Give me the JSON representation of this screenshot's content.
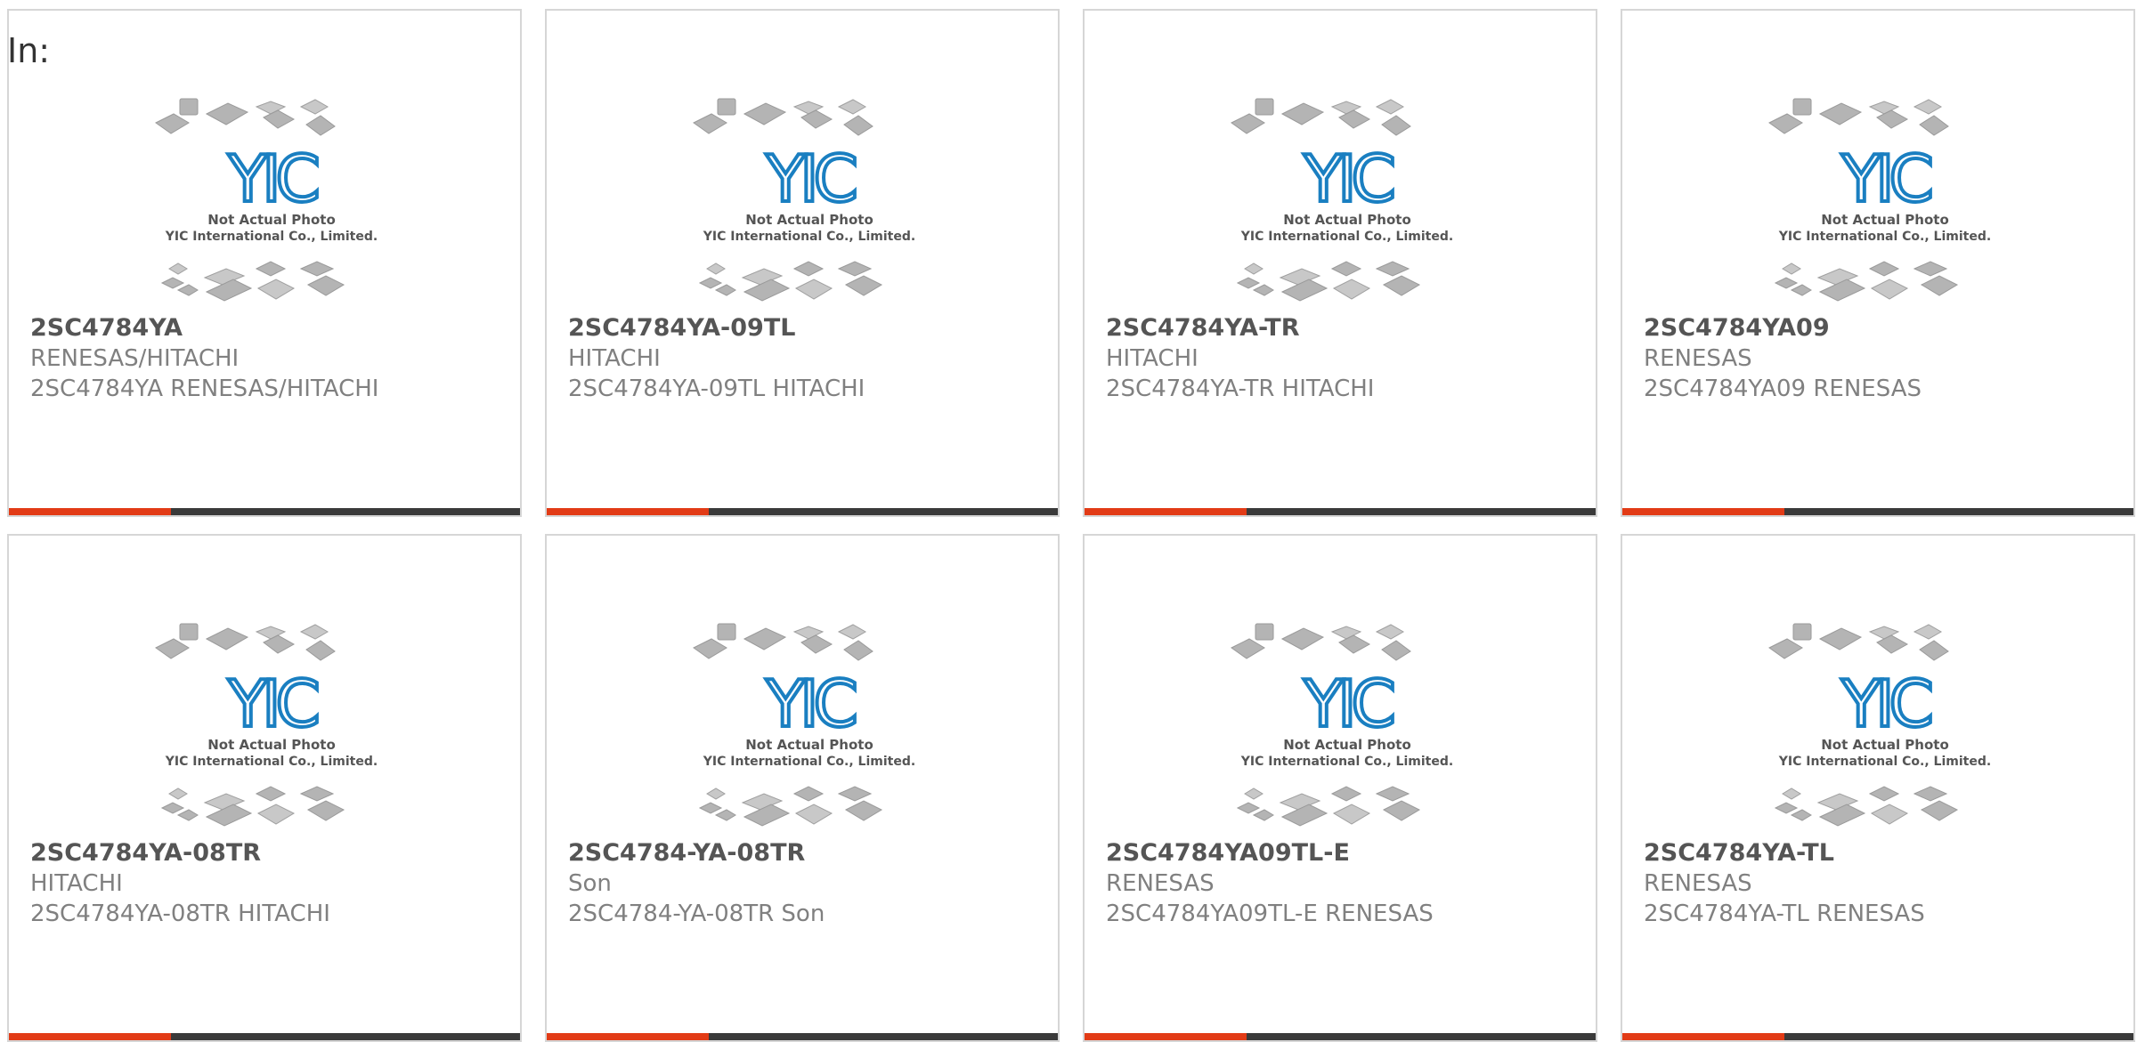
{
  "header": {
    "label": "In:"
  },
  "photo": {
    "logo_text": "YIC",
    "caption_line1": "Not Actual Photo",
    "caption_line2": "YIC International Co., Limited."
  },
  "colors": {
    "accent": "#e23b16",
    "bar": "#3a3a3a",
    "logo": "#1a7fc1",
    "border": "#d6d6d6"
  },
  "products": [
    {
      "part_number": "2SC4784YA",
      "manufacturer": "RENESAS/HITACHI",
      "description": "2SC4784YA RENESAS/HITACHI"
    },
    {
      "part_number": "2SC4784YA-09TL",
      "manufacturer": "HITACHI",
      "description": "2SC4784YA-09TL HITACHI"
    },
    {
      "part_number": "2SC4784YA-TR",
      "manufacturer": "HITACHI",
      "description": "2SC4784YA-TR HITACHI"
    },
    {
      "part_number": "2SC4784YA09",
      "manufacturer": "RENESAS",
      "description": "2SC4784YA09 RENESAS"
    },
    {
      "part_number": "2SC4784YA-08TR",
      "manufacturer": "HITACHI",
      "description": "2SC4784YA-08TR HITACHI"
    },
    {
      "part_number": "2SC4784-YA-08TR",
      "manufacturer": "Son",
      "description": "2SC4784-YA-08TR Son"
    },
    {
      "part_number": "2SC4784YA09TL-E",
      "manufacturer": "RENESAS",
      "description": "2SC4784YA09TL-E RENESAS"
    },
    {
      "part_number": "2SC4784YA-TL",
      "manufacturer": "RENESAS",
      "description": "2SC4784YA-TL RENESAS"
    }
  ]
}
